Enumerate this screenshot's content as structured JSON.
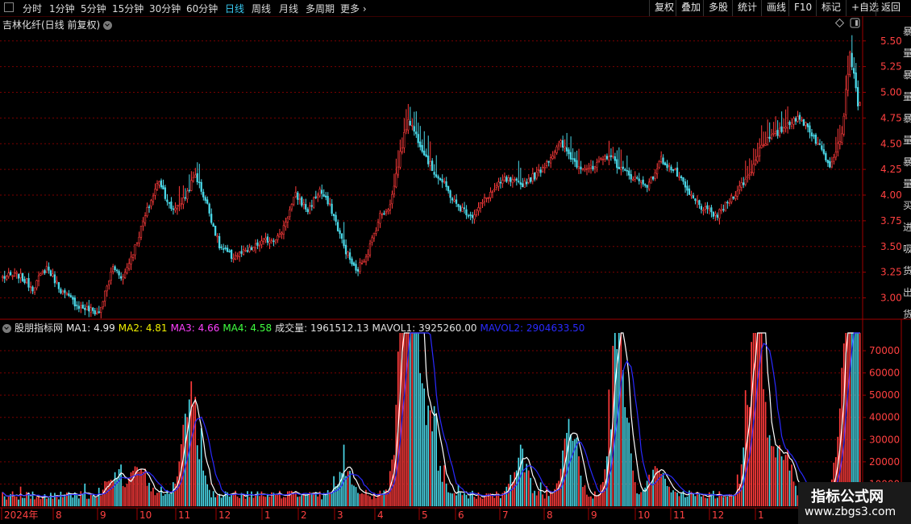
{
  "toolbar": {
    "periods": [
      "分时",
      "1分钟",
      "5分钟",
      "15分钟",
      "30分钟",
      "60分钟",
      "日线",
      "周线",
      "月线",
      "多周期",
      "更多"
    ],
    "active_period": "日线",
    "right_buttons": [
      "复权",
      "叠加",
      "多股",
      "统计",
      "画线",
      "F10",
      "标记",
      "+自选",
      "返回"
    ]
  },
  "stock": {
    "title": "吉林化纤(日线 前复权)"
  },
  "indicator": {
    "name": "股朋指标网",
    "ma1": "MA1: 4.99",
    "ma2": "MA2: 4.81",
    "ma3": "MA3: 4.66",
    "ma4": "MA4: 4.58",
    "vol": "成交量: 1961512.13",
    "mavol1": "MAVOL1: 3925260.00",
    "mavol2": "MAVOL2: 2904633.50"
  },
  "colors": {
    "up": "#ff3b3b",
    "down": "#4ad8e8",
    "grid": "#7a0000",
    "border": "#a00000",
    "ma1": "#e8e8e8",
    "ma2": "#f0f000",
    "ma3": "#ff40ff",
    "ma4": "#40ff40",
    "mavol1": "#ffffff",
    "mavol2": "#2a2aff",
    "axis_text": "#ff4040"
  },
  "chart_data": {
    "type": "candlestick",
    "price_axis": {
      "ticks": [
        "5.50",
        "5.25",
        "5.00",
        "4.75",
        "4.50",
        "4.25",
        "4.00",
        "3.75",
        "3.50",
        "3.25",
        "3.00"
      ],
      "ylim": [
        2.8,
        5.6
      ]
    },
    "volume_axis": {
      "ticks": [
        "70000",
        "60000",
        "50000",
        "40000",
        "30000",
        "20000",
        "10000"
      ],
      "ylim": [
        0,
        78000
      ]
    },
    "x_labels": [
      "2024年",
      "8",
      "9",
      "10",
      "11",
      "12",
      "1",
      "2",
      "3",
      "4",
      "5",
      "6",
      "7",
      "8",
      "9",
      "10",
      "11",
      "12",
      "1"
    ],
    "anchors": [
      [
        0,
        3.2
      ],
      [
        8,
        3.22
      ],
      [
        15,
        3.1
      ],
      [
        22,
        3.3
      ],
      [
        30,
        3.05
      ],
      [
        38,
        2.92
      ],
      [
        48,
        2.85
      ],
      [
        55,
        3.3
      ],
      [
        60,
        3.2
      ],
      [
        66,
        3.5
      ],
      [
        72,
        3.85
      ],
      [
        78,
        4.15
      ],
      [
        84,
        3.85
      ],
      [
        90,
        3.95
      ],
      [
        96,
        4.2
      ],
      [
        102,
        3.9
      ],
      [
        108,
        3.5
      ],
      [
        114,
        3.4
      ],
      [
        122,
        3.45
      ],
      [
        130,
        3.55
      ],
      [
        138,
        3.6
      ],
      [
        146,
        4.0
      ],
      [
        152,
        3.85
      ],
      [
        158,
        4.05
      ],
      [
        164,
        3.85
      ],
      [
        170,
        3.5
      ],
      [
        176,
        3.25
      ],
      [
        182,
        3.45
      ],
      [
        188,
        3.8
      ],
      [
        193,
        3.9
      ],
      [
        198,
        4.4
      ],
      [
        202,
        4.75
      ],
      [
        208,
        4.5
      ],
      [
        214,
        4.25
      ],
      [
        220,
        4.1
      ],
      [
        226,
        3.9
      ],
      [
        234,
        3.8
      ],
      [
        242,
        4.0
      ],
      [
        250,
        4.15
      ],
      [
        258,
        4.1
      ],
      [
        266,
        4.2
      ],
      [
        272,
        4.35
      ],
      [
        278,
        4.5
      ],
      [
        286,
        4.3
      ],
      [
        294,
        4.25
      ],
      [
        302,
        4.4
      ],
      [
        308,
        4.25
      ],
      [
        316,
        4.15
      ],
      [
        322,
        4.1
      ],
      [
        328,
        4.35
      ],
      [
        336,
        4.2
      ],
      [
        342,
        4.0
      ],
      [
        350,
        3.85
      ],
      [
        356,
        3.8
      ],
      [
        362,
        3.95
      ],
      [
        368,
        4.1
      ],
      [
        372,
        4.2
      ],
      [
        378,
        4.5
      ],
      [
        386,
        4.6
      ],
      [
        394,
        4.75
      ],
      [
        400,
        4.7
      ],
      [
        406,
        4.5
      ],
      [
        412,
        4.3
      ],
      [
        418,
        4.6
      ],
      [
        422,
        5.4
      ],
      [
        426,
        4.9
      ]
    ],
    "volume_spikes": [
      [
        55,
        12000
      ],
      [
        68,
        15000
      ],
      [
        92,
        33000
      ],
      [
        95,
        27000
      ],
      [
        170,
        15000
      ],
      [
        200,
        74000
      ],
      [
        203,
        62000
      ],
      [
        206,
        52000
      ],
      [
        214,
        30000
      ],
      [
        258,
        20000
      ],
      [
        283,
        36000
      ],
      [
        306,
        44000
      ],
      [
        308,
        35000
      ],
      [
        326,
        14000
      ],
      [
        374,
        62000
      ],
      [
        378,
        36000
      ],
      [
        388,
        25000
      ],
      [
        420,
        58000
      ],
      [
        423,
        58000
      ],
      [
        425,
        40000
      ]
    ],
    "series": [
      {
        "name": "MA1",
        "values": [
          4.99
        ]
      },
      {
        "name": "MAVOL1",
        "values": [
          3925260.0
        ]
      },
      {
        "name": "MAVOL2",
        "values": [
          2904633.5
        ]
      }
    ]
  },
  "right_strip": {
    "text": "暴量暴量暴量暴量买进吸货出货"
  },
  "watermark": {
    "line1": "指标公式网",
    "line2": "www.zbgs3.com"
  }
}
